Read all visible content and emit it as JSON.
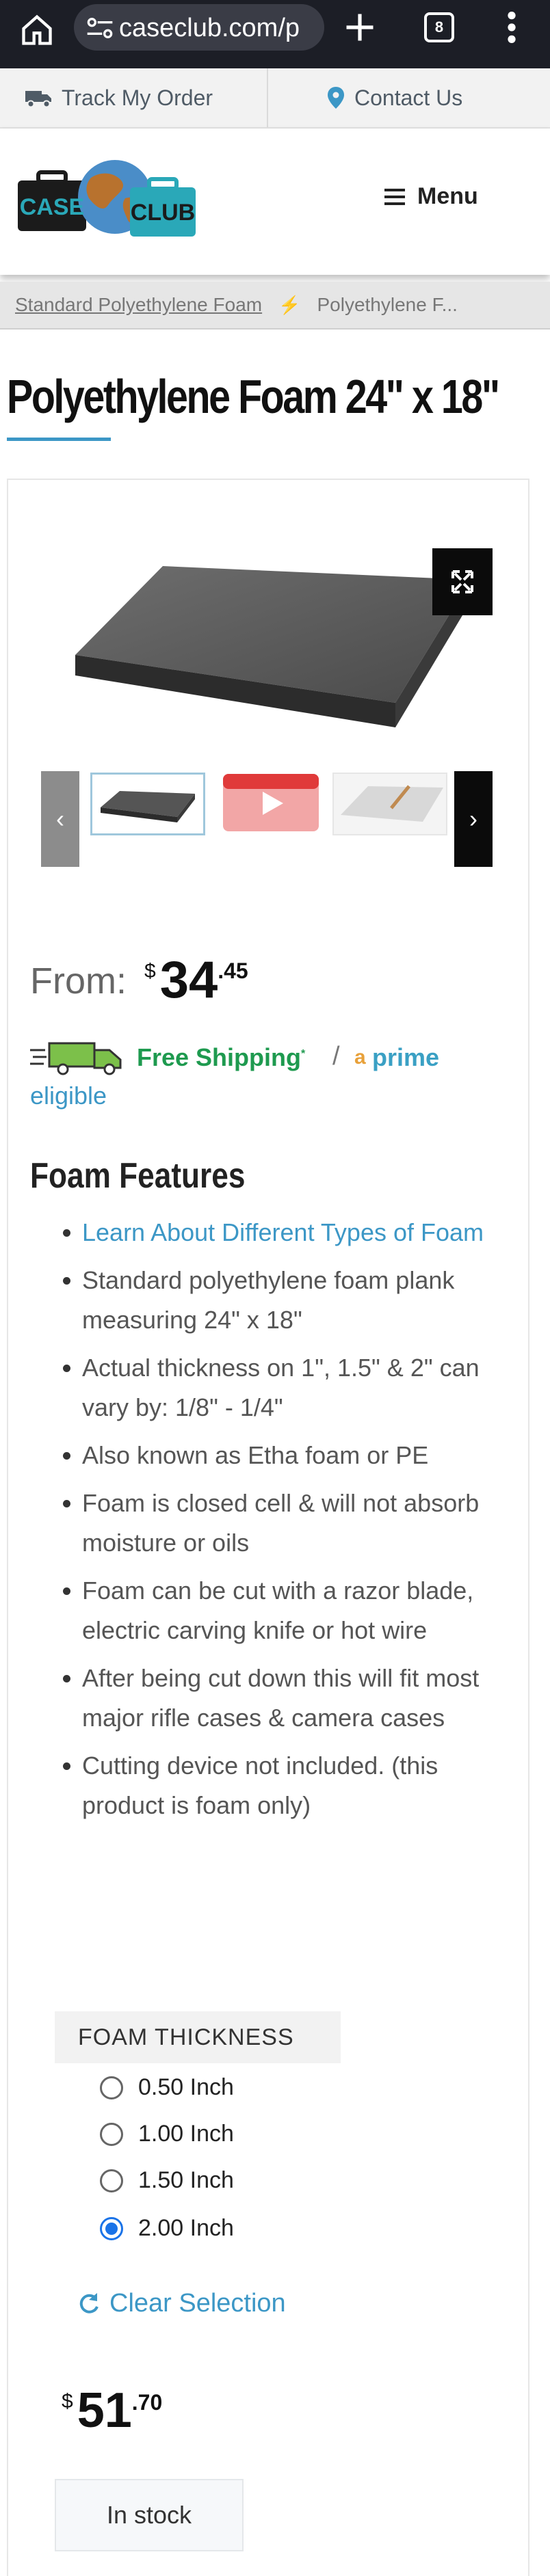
{
  "browser": {
    "url": "caseclub.com/p",
    "tab_count": "8"
  },
  "top_nav": {
    "track_label": "Track My Order",
    "contact_label": "Contact Us"
  },
  "header": {
    "logo_text_left": "CASE",
    "logo_text_right": "CLUB",
    "menu_label": "Menu"
  },
  "breadcrumb": {
    "parent": "Standard Polyethylene Foam",
    "current": "Polyethylene F..."
  },
  "product": {
    "title": "Polyethylene Foam 24\" x 18\"",
    "from_label": "From:",
    "currency": "$",
    "price_whole": "34",
    "price_cents": ".45",
    "shipping_label": "Free Shipping",
    "shipping_mark": "*",
    "prime_a": "a",
    "prime_label": "prime",
    "eligible_label": "eligible",
    "features_title": "Foam Features",
    "features": [
      "Learn About Different Types of Foam",
      "Standard polyethylene foam plank measuring 24\" x 18\"",
      "Actual thickness on 1\", 1.5\" & 2\" can vary by: 1/8\" - 1/4\"",
      "Also known as Etha foam or PE",
      "Foam is closed cell & will not absorb moisture or oils",
      "Foam can be cut with a razor blade, electric carving knife or hot wire",
      "After being cut down this will fit most major rifle cases & camera cases",
      "Cutting device not included. (this product is foam only)"
    ],
    "thickness_label": "FOAM THICKNESS",
    "thickness_options": [
      "0.50 Inch",
      "1.00 Inch",
      "1.50 Inch",
      "2.00 Inch"
    ],
    "thickness_selected": "2.00 Inch",
    "clear_label": "Clear Selection",
    "selected_price_whole": "51",
    "selected_price_cents": ".70",
    "stock_status": "In stock"
  },
  "colors": {
    "accent_blue": "#3c97c6",
    "shipping_green": "#1e9a4f",
    "prime_orange": "#e8a13a"
  }
}
